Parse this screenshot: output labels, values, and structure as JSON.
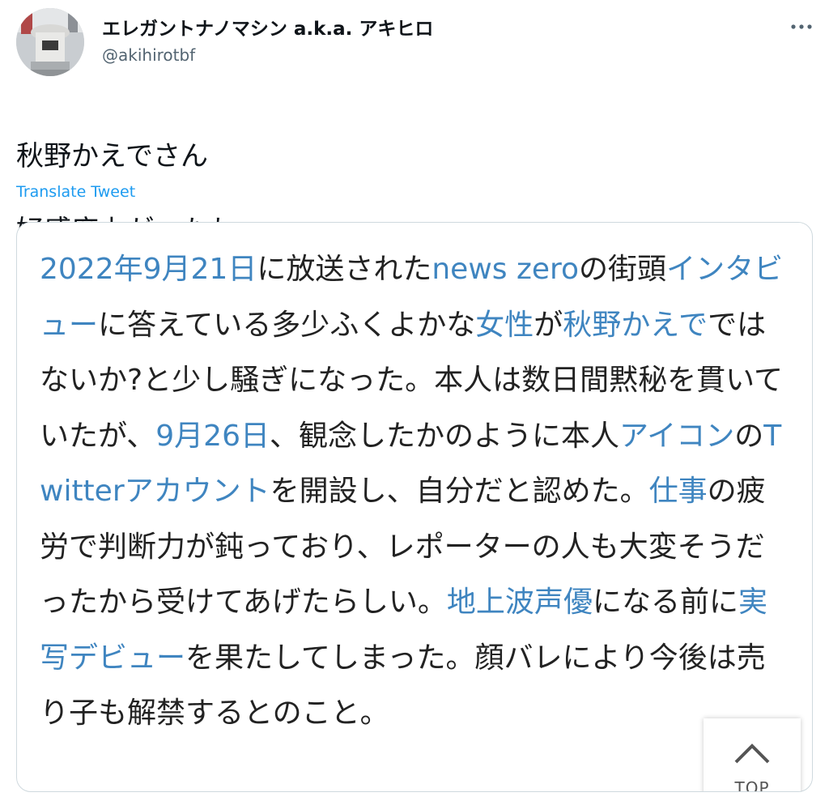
{
  "user": {
    "display_name": "エレガントナノマシン a.k.a. アキヒロ",
    "handle": "@akihirotbf",
    "avatar_icon": "statue-photo-avatar"
  },
  "tweet": {
    "lines": [
      "秋野かえでさん",
      "好感度上がったわwww"
    ],
    "translate_label": "Translate Tweet"
  },
  "embedded": {
    "segments": [
      {
        "text": "2022年9月21日",
        "link": true
      },
      {
        "text": "に放送された",
        "link": false
      },
      {
        "text": "news zero",
        "link": true
      },
      {
        "text": "の街頭",
        "link": false
      },
      {
        "text": "インタビュー",
        "link": true
      },
      {
        "text": "に答えている多少ふくよかな",
        "link": false
      },
      {
        "text": "女性",
        "link": true
      },
      {
        "text": "が",
        "link": false
      },
      {
        "text": "秋野かえで",
        "link": true
      },
      {
        "text": "ではないか?と少し騒ぎになった。本人は数日間黙秘を貫いていたが、",
        "link": false
      },
      {
        "text": "9月26日",
        "link": true
      },
      {
        "text": "、観念したかのように本人",
        "link": false
      },
      {
        "text": "アイコン",
        "link": true
      },
      {
        "text": "の",
        "link": false
      },
      {
        "text": "Twitterアカウント",
        "link": true
      },
      {
        "text": "を開設し、自分だと認めた。",
        "link": false
      },
      {
        "text": "仕事",
        "link": true
      },
      {
        "text": "の疲労で判断力が鈍っており、レポーターの人も大変そうだったから受けてあげたらしい。",
        "link": false
      },
      {
        "text": "地上波",
        "link": true
      },
      {
        "text": "声優",
        "link": true
      },
      {
        "text": "になる前に",
        "link": false
      },
      {
        "text": "実写デビュー",
        "link": true
      },
      {
        "text": "を果たしてしまった。顔バレにより今後は売り子も解禁するとのこと。",
        "link": false
      }
    ],
    "top_button_label": "TOP"
  },
  "colors": {
    "link": "#3f85c0",
    "translate": "#1d9bf0",
    "handle": "#536471"
  }
}
